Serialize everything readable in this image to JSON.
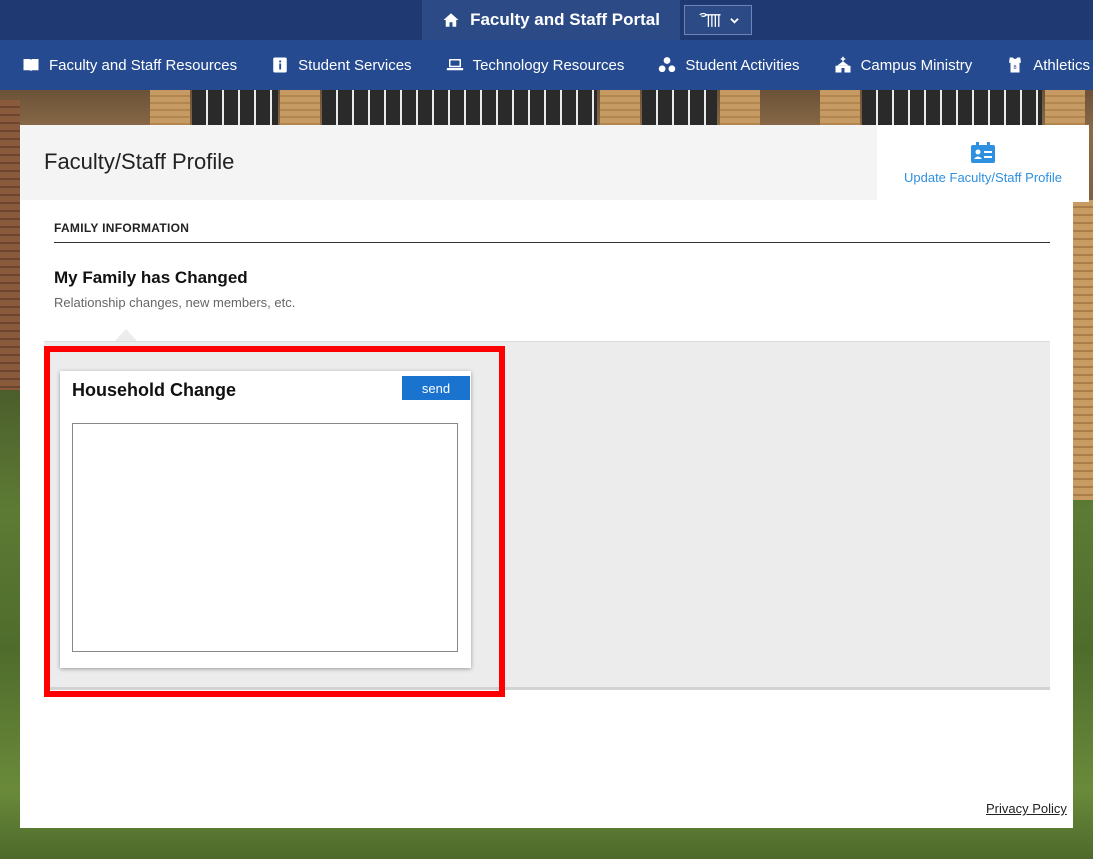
{
  "portal": {
    "title": "Faculty and Staff Portal"
  },
  "nav": {
    "items": [
      {
        "label": "Faculty and Staff Resources",
        "icon": "book-icon"
      },
      {
        "label": "Student Services",
        "icon": "info-icon"
      },
      {
        "label": "Technology Resources",
        "icon": "laptop-icon"
      },
      {
        "label": "Student Activities",
        "icon": "group-icon"
      },
      {
        "label": "Campus Ministry",
        "icon": "church-icon"
      },
      {
        "label": "Athletics",
        "icon": "jersey-icon"
      }
    ]
  },
  "page": {
    "title": "Faculty/Staff Profile",
    "update_link": "Update Faculty/Staff Profile"
  },
  "family": {
    "section_heading": "FAMILY INFORMATION",
    "card_title": "My Family has Changed",
    "card_subtitle": "Relationship changes, new members, etc."
  },
  "household": {
    "title": "Household Change",
    "send_label": "send",
    "text_value": ""
  },
  "footer": {
    "privacy": "Privacy Policy"
  },
  "colors": {
    "topbar": "#1f3a72",
    "nav": "#254a8f",
    "accent": "#1a73cf",
    "highlight": "#ff0000"
  }
}
